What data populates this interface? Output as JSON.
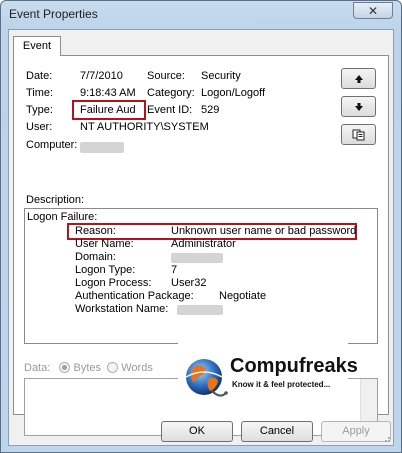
{
  "window": {
    "title": "Event Properties",
    "close_glyph": "✕"
  },
  "tabs": [
    {
      "label": "Event"
    }
  ],
  "event": {
    "date_label": "Date:",
    "date_value": "7/7/2010",
    "source_label": "Source:",
    "source_value": "Security",
    "time_label": "Time:",
    "time_value": "9:18:43 AM",
    "category_label": "Category:",
    "category_value": "Logon/Logoff",
    "type_label": "Type:",
    "type_value": "Failure Aud",
    "event_id_label": "Event ID:",
    "event_id_value": "529",
    "user_label": "User:",
    "user_value": "NT AUTHORITY\\SYSTEM",
    "computer_label": "Computer:"
  },
  "nav": {
    "up_icon": "arrow-up-icon",
    "down_icon": "arrow-down-icon",
    "copy_icon": "copy-icon"
  },
  "description": {
    "label": "Description:",
    "heading": "Logon Failure:",
    "fields": [
      {
        "name": "Reason:",
        "value": "Unknown user name or bad password"
      },
      {
        "name": "User Name:",
        "value": "Administrator"
      },
      {
        "name": "Domain:",
        "value": ""
      },
      {
        "name": "Logon Type:",
        "value": "7"
      },
      {
        "name": "Logon Process:",
        "value": "User32"
      },
      {
        "name": "Authentication Package:",
        "value": "Negotiate"
      },
      {
        "name": "Workstation Name:",
        "value": ""
      }
    ]
  },
  "data_section": {
    "label": "Data:",
    "bytes_label": "Bytes",
    "words_label": "Words",
    "selected": "Bytes"
  },
  "watermark": {
    "brand": "Compufreaks",
    "tagline": "Know it & feel protected..."
  },
  "buttons": {
    "ok": "OK",
    "cancel": "Cancel",
    "apply": "Apply"
  },
  "colors": {
    "highlight_border": "#b5121b",
    "brand_blue": "#1a4fa0",
    "brand_orange": "#e8731c"
  }
}
